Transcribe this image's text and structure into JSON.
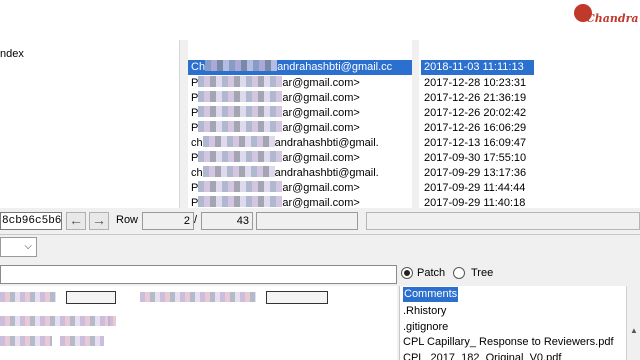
{
  "brand": {
    "logo_text": "Chandra",
    "color": "#c0392b"
  },
  "tree": {
    "label": "ndex"
  },
  "commits": [
    {
      "author_prefix": "Ch",
      "author_suffix": "andrahashbti@gmail.cc",
      "date": "2018-11-03 11:11:13",
      "selected": true
    },
    {
      "author_prefix": "P",
      "author_suffix": "ar@gmail.com>",
      "date": "2017-12-28 10:23:31"
    },
    {
      "author_prefix": "P",
      "author_suffix": "ar@gmail.com>",
      "date": "2017-12-26 21:36:19"
    },
    {
      "author_prefix": "P",
      "author_suffix": "ar@gmail.com>",
      "date": "2017-12-26 20:02:42"
    },
    {
      "author_prefix": "P",
      "author_suffix": "ar@gmail.com>",
      "date": "2017-12-26 16:06:29"
    },
    {
      "author_prefix": "ch",
      "author_suffix": "andrahashbti@gmail.",
      "date": "2017-12-13 16:09:47"
    },
    {
      "author_prefix": "P",
      "author_suffix": "ar@gmail.com>",
      "date": "2017-09-30 17:55:10"
    },
    {
      "author_prefix": "ch",
      "author_suffix": "andrahashbti@gmail.",
      "date": "2017-09-29 13:17:36"
    },
    {
      "author_prefix": "P",
      "author_suffix": "ar@gmail.com>",
      "date": "2017-09-29 11:44:44"
    },
    {
      "author_prefix": "P",
      "author_suffix": "ar@gmail.com>",
      "date": "2017-09-29 11:40:18"
    }
  ],
  "toolbar": {
    "sha": "8cb96c5b6",
    "back_icon": "arrow-left-icon",
    "back_symbol": "←",
    "forward_icon": "arrow-right-icon",
    "forward_symbol": "→",
    "row_label": "Row",
    "row_current": "2",
    "row_separator": "/",
    "row_total": "43"
  },
  "find": {
    "dropdown_symbol": "⌵"
  },
  "view_mode": {
    "patch_label": "Patch",
    "tree_label": "Tree",
    "selected": "Patch"
  },
  "files": {
    "items": [
      "Comments",
      ".Rhistory",
      ".gitignore",
      "CPL Capillary_ Response to Reviewers.pdf",
      "CPL_2017_182_Original_V0.pdf"
    ],
    "selected_index": 0
  }
}
